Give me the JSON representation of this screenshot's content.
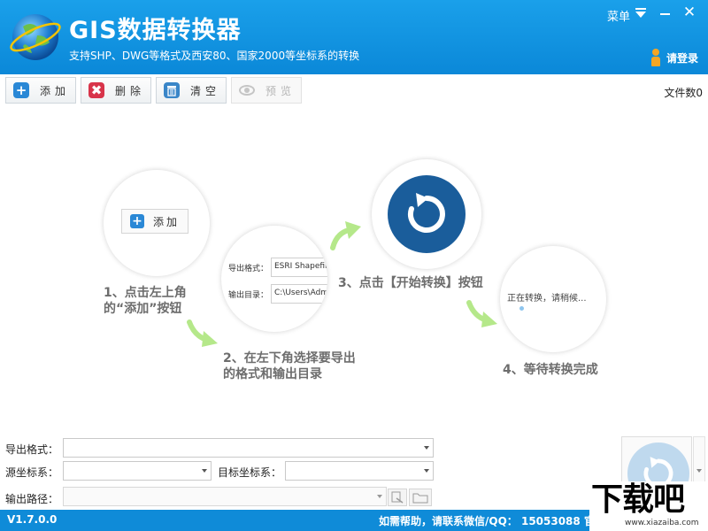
{
  "header": {
    "title": "GIS数据转换器",
    "subtitle": "支持SHP、DWG等格式及西安80、国家2000等坐标系的转换",
    "menu_label": "菜单",
    "login_label": "请登录"
  },
  "toolbar": {
    "add_label": "添加",
    "delete_label": "删除",
    "clear_label": "清空",
    "preview_label": "预览",
    "file_count_label": "文件数",
    "file_count_value": "0"
  },
  "guide": {
    "step1": "1、点击左上角的“添加”按钮",
    "step2": "2、在左下角选择要导出的格式和输出目录",
    "step3": "3、点击【开始转换】按钮",
    "step4": "4、等待转换完成",
    "mini_add_label": "添加",
    "mini_export_label": "导出格式：",
    "mini_export_value": "ESRI Shapefile",
    "mini_output_label": "输出目录：",
    "mini_output_value": "C:\\Users\\Adm",
    "progress_text": "正在转换，请稍候..."
  },
  "form": {
    "export_format_label": "导出格式：",
    "export_format_value": "",
    "source_crs_label": "源坐标系：",
    "source_crs_value": "",
    "target_crs_label": "目标坐标系：",
    "target_crs_value": "",
    "output_path_label": "输出路径：",
    "output_path_value": ""
  },
  "status": {
    "version": "V1.7.0.0",
    "help_text": "如需帮助，请联系微信/QQ：  15053088  官"
  },
  "watermark": {
    "main": "下载吧",
    "url": "www.xiazaiba.com"
  },
  "colors": {
    "header_blue": "#0b88d8",
    "accent_dark_blue": "#1a5d9b",
    "arrow_green": "#b5e88a",
    "step_text_gray": "#6d6d6d"
  }
}
